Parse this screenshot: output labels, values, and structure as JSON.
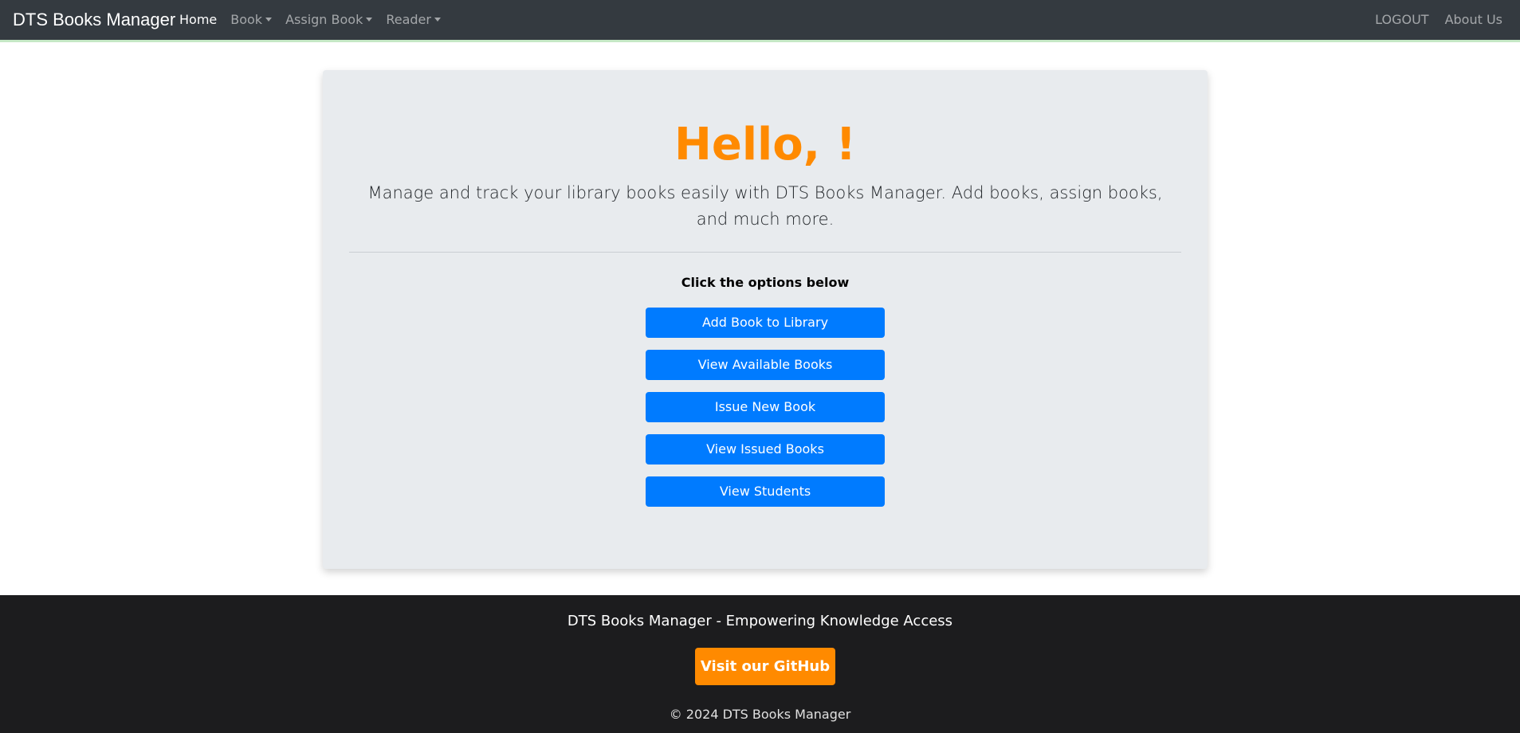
{
  "navbar": {
    "brand": "DTS Books Manager",
    "left_items": [
      {
        "label": "Home",
        "active": true,
        "dropdown": false
      },
      {
        "label": "Book",
        "active": false,
        "dropdown": true
      },
      {
        "label": "Assign Book",
        "active": false,
        "dropdown": true
      },
      {
        "label": "Reader",
        "active": false,
        "dropdown": true
      }
    ],
    "right_items": [
      {
        "label": "LOGOUT"
      },
      {
        "label": "About Us"
      }
    ]
  },
  "main": {
    "greeting": "Hello, !",
    "lead": "Manage and track your library books easily with DTS Books Manager. Add books, assign books, and much more.",
    "options_label": "Click the options below",
    "buttons": [
      {
        "label": "Add Book to Library"
      },
      {
        "label": "View Available Books"
      },
      {
        "label": "Issue New Book"
      },
      {
        "label": "View Issued Books"
      },
      {
        "label": "View Students"
      }
    ]
  },
  "footer": {
    "tagline": "DTS Books Manager - Empowering Knowledge Access",
    "github_label": "Visit our GitHub",
    "copyright": "© 2024 DTS Books Manager"
  },
  "colors": {
    "navbar_bg": "#343a40",
    "accent_orange": "#ff8a00",
    "button_blue": "#007bff",
    "jumbotron_bg": "#e8ebee",
    "footer_bg": "#1c1c1e"
  }
}
